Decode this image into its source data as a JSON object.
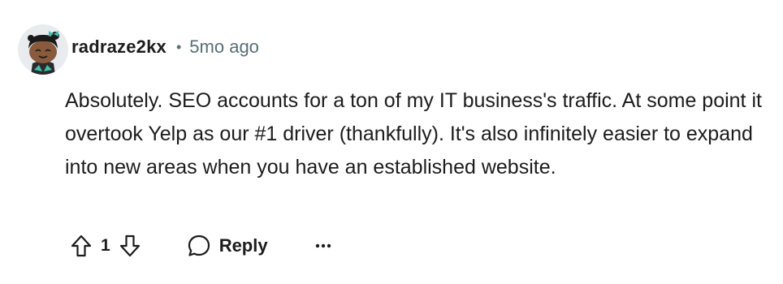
{
  "comment": {
    "author": "radraze2kx",
    "separator": "•",
    "time_ago": "5mo ago",
    "body": "Absolutely. SEO accounts for a ton of my IT business's traffic. At some point it overtook Yelp as our #1 driver (thankfully). It's also infinitely easier to expand into new areas when you have an established website.",
    "score": "1",
    "reply_label": "Reply"
  },
  "icons": {
    "avatar": "snoo-avatar-icon",
    "upvote": "upvote-arrow-icon",
    "downvote": "downvote-arrow-icon",
    "reply": "speech-bubble-icon",
    "more": "more-options-icon"
  },
  "colors": {
    "text": "#1c1c1c",
    "meta": "#576f76",
    "avatar_bg": "#e9ecef",
    "accent_teal": "#3fc1b0"
  }
}
